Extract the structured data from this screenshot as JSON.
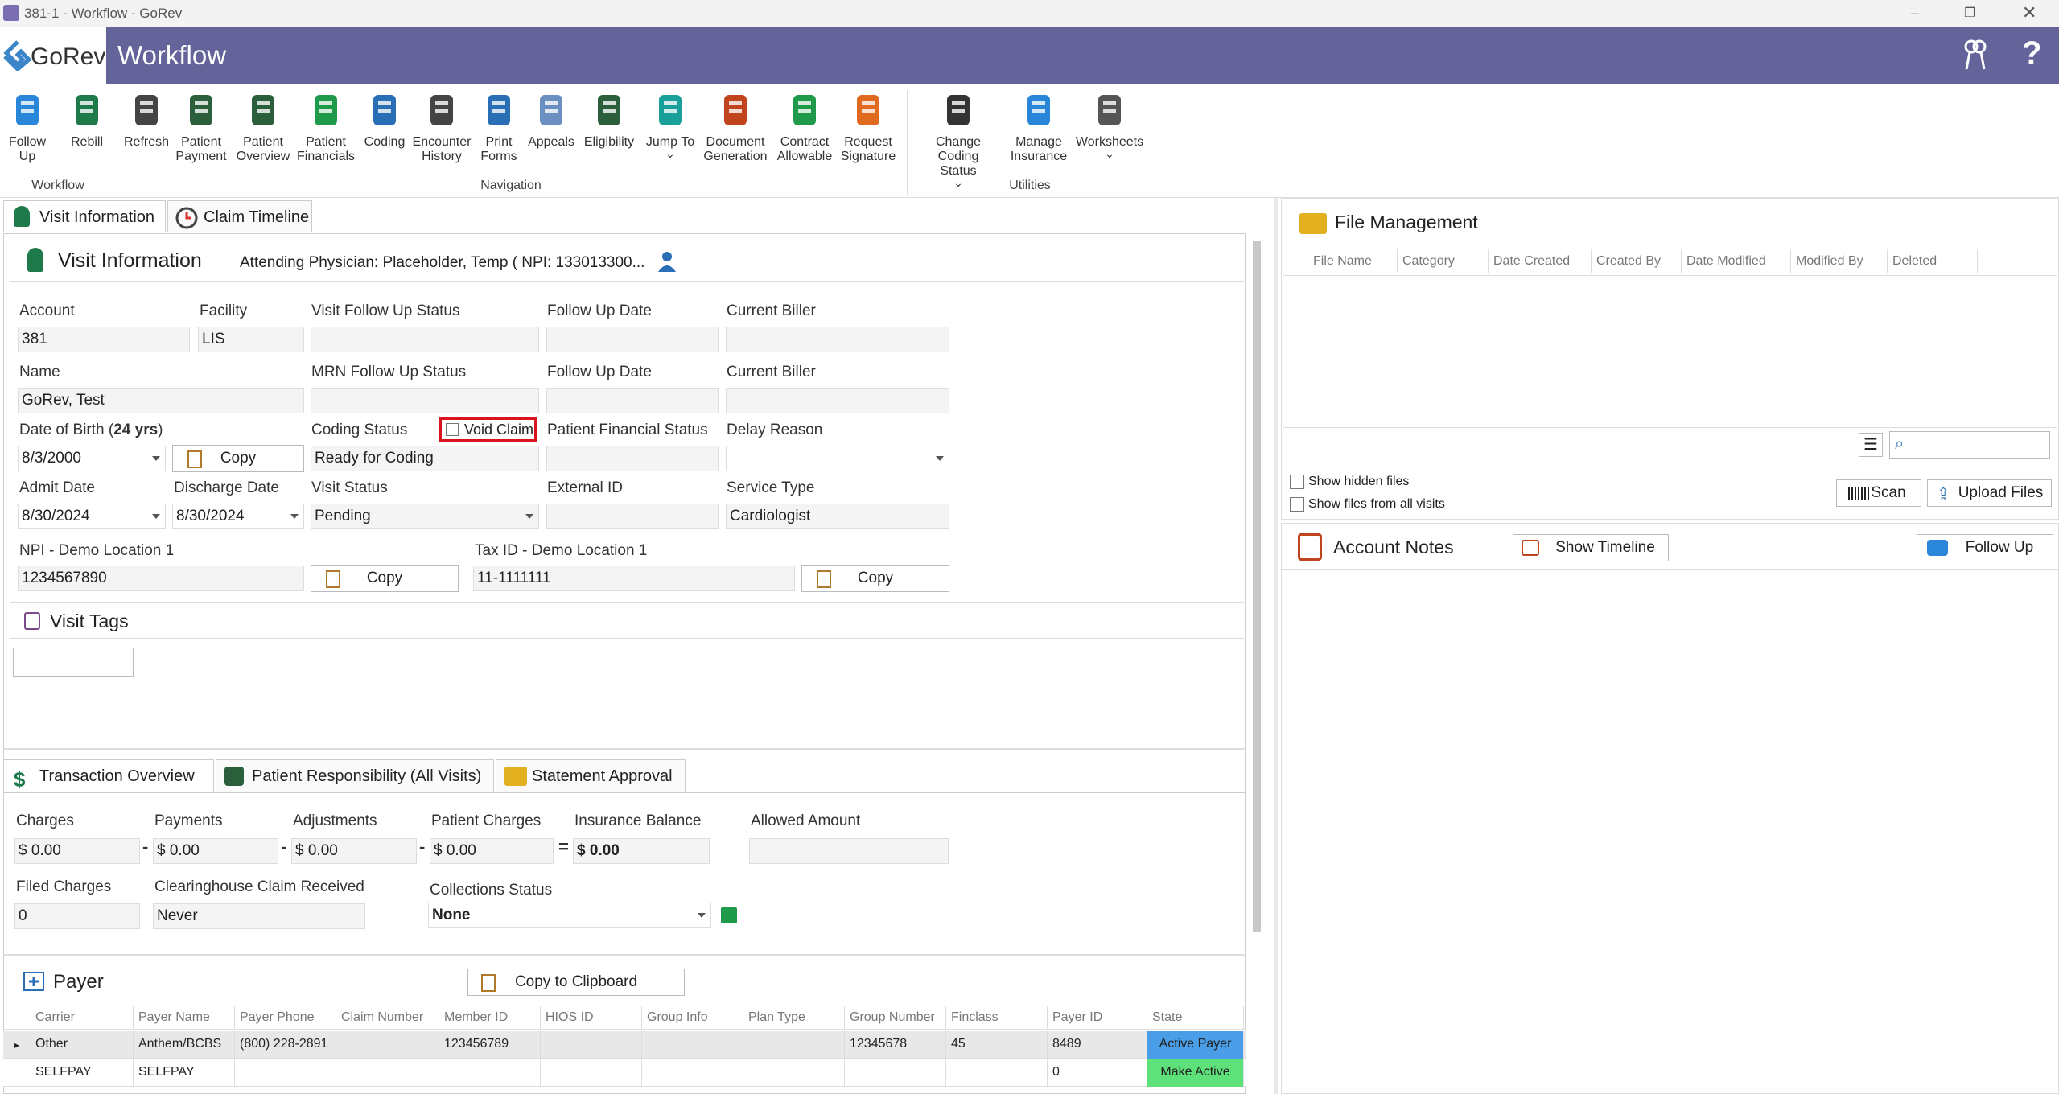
{
  "window": {
    "title": "381-1 - Workflow - GoRev"
  },
  "app": {
    "logo": "GoRev",
    "title": "Workflow"
  },
  "ribbon": {
    "workflow": [
      {
        "label": "Follow\nUp",
        "icon": "chat-icon"
      },
      {
        "label": "Rebill",
        "icon": "dollar-cycle-icon"
      }
    ],
    "workflow_group": "Workflow",
    "navigation": [
      {
        "label": "Refresh",
        "icon": "refresh-icon"
      },
      {
        "label": "Patient\nPayment",
        "icon": "payment-icon"
      },
      {
        "label": "Patient\nOverview",
        "icon": "person-icon"
      },
      {
        "label": "Patient\nFinancials",
        "icon": "dollar-icon"
      },
      {
        "label": "Coding",
        "icon": "book-icon"
      },
      {
        "label": "Encounter\nHistory",
        "icon": "calendar-icon"
      },
      {
        "label": "Print\nForms",
        "icon": "printer-icon"
      },
      {
        "label": "Appeals",
        "icon": "docs-icon"
      },
      {
        "label": "Eligibility",
        "icon": "user-check-icon"
      },
      {
        "label": "Jump To",
        "icon": "arrow-icon"
      },
      {
        "label": "Document\nGeneration",
        "icon": "robot-icon"
      },
      {
        "label": "Contract\nAllowable",
        "icon": "contract-icon"
      },
      {
        "label": "Request\nSignature",
        "icon": "pen-icon"
      }
    ],
    "navigation_group": "Navigation",
    "utilities": [
      {
        "label": "Change Coding\nStatus",
        "icon": "doc-edit-icon"
      },
      {
        "label": "Manage\nInsurance",
        "icon": "shield-icon"
      },
      {
        "label": "Worksheets",
        "icon": "sheets-icon"
      }
    ],
    "utilities_group": "Utilities"
  },
  "tabs": {
    "visit_info": "Visit Information",
    "claim_timeline": "Claim Timeline"
  },
  "visit": {
    "header": "Visit Information",
    "physician": "Attending Physician: Placeholder, Temp ( NPI: 133013300...",
    "account_label": "Account",
    "account": "381",
    "facility_label": "Facility",
    "facility": "LIS",
    "visit_fu_status_label": "Visit Follow Up Status",
    "visit_fu_status": "",
    "fu_date_label": "Follow Up Date",
    "fu_date": "",
    "biller_label": "Current Biller",
    "biller": "",
    "name_label": "Name",
    "name": "GoRev, Test",
    "mrn_fu_label": "MRN Follow Up Status",
    "mrn_fu": "",
    "fu_date2_label": "Follow Up Date",
    "fu_date2": "",
    "biller2_label": "Current Biller",
    "biller2": "",
    "dob_label": "Date of Birth (",
    "dob_age": "24 yrs",
    "dob_close": ")",
    "dob": "8/3/2000",
    "copy": "Copy",
    "coding_status_label": "Coding Status",
    "coding_status": "Ready for Coding",
    "void_claim": "Void Claim",
    "pfs_label": "Patient Financial Status",
    "pfs": "",
    "delay_label": "Delay Reason",
    "delay": "",
    "admit_label": "Admit Date",
    "admit": "8/30/2024",
    "discharge_label": "Discharge Date",
    "discharge": "8/30/2024",
    "visit_status_label": "Visit Status",
    "visit_status": "Pending",
    "ext_id_label": "External ID",
    "ext_id": "",
    "service_label": "Service Type",
    "service": "Cardiologist",
    "npi_label": "NPI - Demo Location 1",
    "npi": "1234567890",
    "tax_label": "Tax ID - Demo Location 1",
    "tax": "11-1111111"
  },
  "tags": {
    "header": "Visit Tags"
  },
  "tx_tabs": {
    "overview": "Transaction Overview",
    "resp": "Patient Responsibility (All Visits)",
    "statement": "Statement Approval"
  },
  "tx": {
    "charges_label": "Charges",
    "charges": "$ 0.00",
    "payments_label": "Payments",
    "payments": "$ 0.00",
    "adjust_label": "Adjustments",
    "adjust": "$ 0.00",
    "pcharges_label": "Patient Charges",
    "pcharges": "$ 0.00",
    "ins_bal_label": "Insurance Balance",
    "ins_bal": "$ 0.00",
    "allowed_label": "Allowed Amount",
    "allowed": "",
    "filed_label": "Filed Charges",
    "filed": "0",
    "ch_label": "Clearinghouse Claim Received",
    "ch": "Never",
    "coll_label": "Collections Status",
    "coll": "None",
    "minus": "-",
    "equals": "="
  },
  "payer": {
    "header": "Payer",
    "copy": "Copy to Clipboard",
    "columns": [
      "Carrier",
      "Payer Name",
      "Payer Phone",
      "Claim Number",
      "Member ID",
      "HIOS ID",
      "Group Info",
      "Plan Type",
      "Group Number",
      "Finclass",
      "Payer ID",
      "State"
    ],
    "rows": [
      [
        "Other",
        "Anthem/BCBS",
        "(800) 228-2891",
        "",
        "123456789",
        "",
        "",
        "",
        "12345678",
        "45",
        "8489",
        "Active Payer"
      ],
      [
        "SELFPAY",
        "SELFPAY",
        "",
        "",
        "",
        "",
        "",
        "",
        "",
        "",
        "0",
        "Make Active"
      ]
    ],
    "state_colors": [
      "#4a9ee8",
      "#5ee07a"
    ]
  },
  "files": {
    "header": "File Management",
    "columns": [
      "File Name",
      "Category",
      "Date Created",
      "Created By",
      "Date Modified",
      "Modified By",
      "Deleted"
    ],
    "search_placeholder": "",
    "show_hidden": "Show hidden files",
    "show_all": "Show files from all visits",
    "scan": "Scan",
    "upload": "Upload Files"
  },
  "notes": {
    "header": "Account Notes",
    "timeline": "Show Timeline",
    "follow_up": "Follow Up"
  }
}
